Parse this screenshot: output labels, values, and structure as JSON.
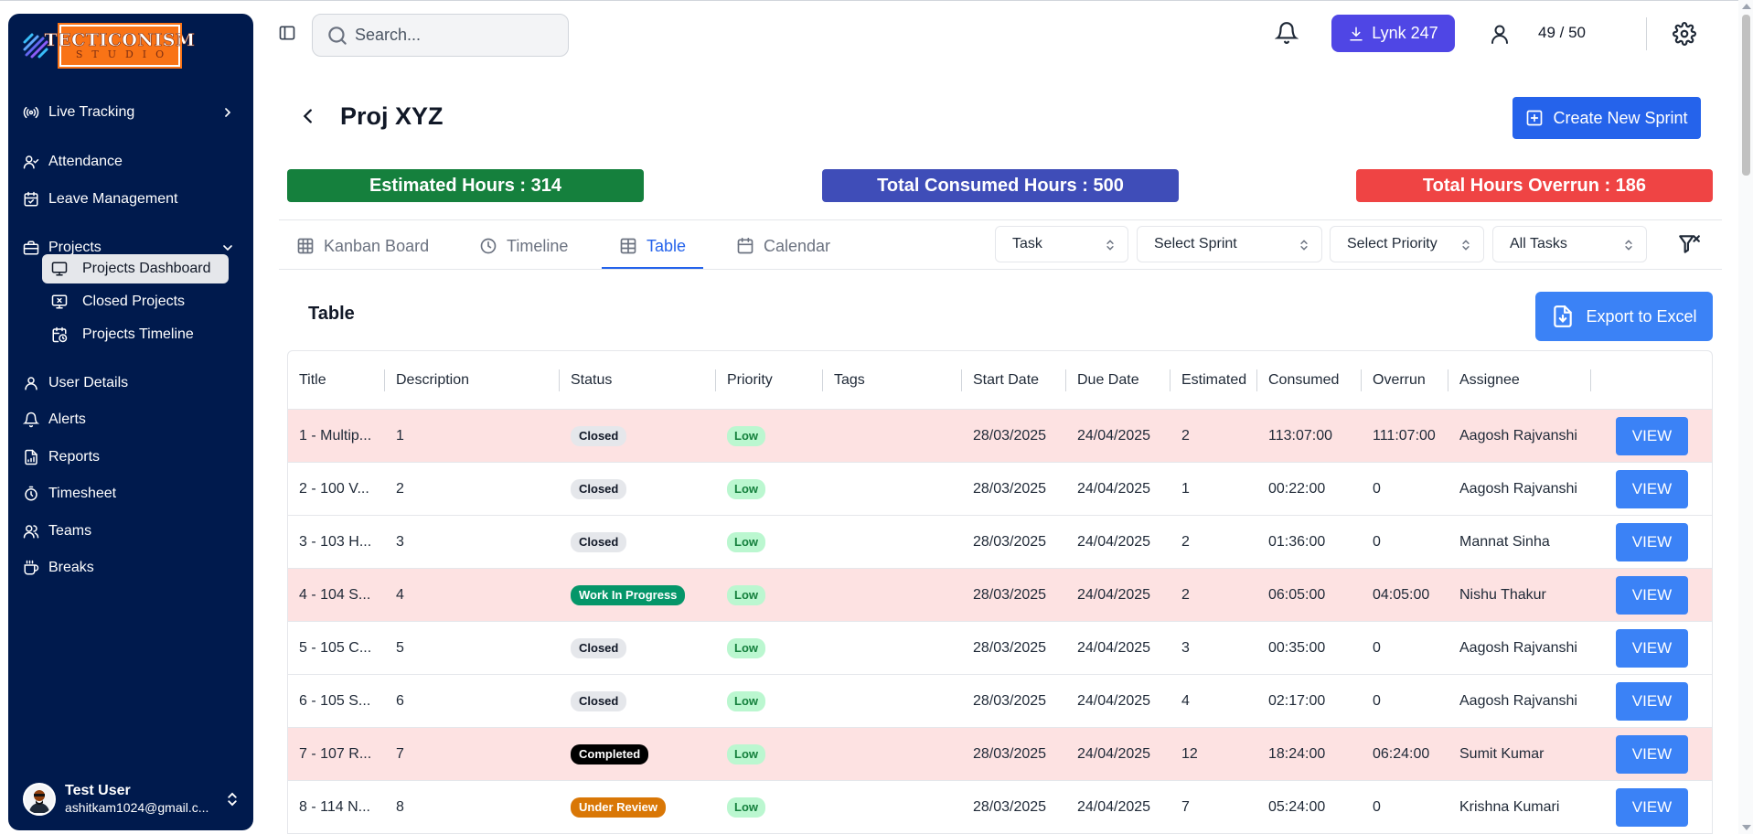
{
  "brand": {
    "logo_line1": "TECTICONISM",
    "logo_line2": "STUDIO"
  },
  "sidebar": {
    "items": [
      {
        "label": "Live Tracking"
      },
      {
        "label": "Attendance"
      },
      {
        "label": "Leave Management"
      },
      {
        "label": "Projects"
      },
      {
        "label": "User Details"
      },
      {
        "label": "Alerts"
      },
      {
        "label": "Reports"
      },
      {
        "label": "Timesheet"
      },
      {
        "label": "Teams"
      },
      {
        "label": "Breaks"
      }
    ],
    "sub_items": [
      {
        "label": "Projects Dashboard",
        "active": true
      },
      {
        "label": "Closed Projects"
      },
      {
        "label": "Projects Timeline"
      }
    ],
    "user": {
      "name": "Test User",
      "email": "ashitkam1024@gmail.c..."
    }
  },
  "topbar": {
    "search_placeholder": "Search...",
    "lynk_label": "Lynk 247",
    "user_count": "49 / 50"
  },
  "header": {
    "title": "Proj XYZ",
    "create_label": "Create New Sprint"
  },
  "stats": {
    "estimated": "Estimated Hours : 314",
    "consumed": "Total Consumed Hours : 500",
    "overrun": "Total Hours Overrun : 186"
  },
  "tabs": [
    {
      "label": "Kanban Board"
    },
    {
      "label": "Timeline"
    },
    {
      "label": "Table",
      "active": true
    },
    {
      "label": "Calendar"
    }
  ],
  "filters": {
    "type": "Task",
    "sprint": "Select Sprint",
    "priority": "Select Priority",
    "tasks": "All Tasks"
  },
  "table": {
    "section_title": "Table",
    "export_label": "Export to Excel",
    "columns": [
      "Title",
      "Description",
      "Status",
      "Priority",
      "Tags",
      "Start Date",
      "Due Date",
      "Estimated",
      "Consumed",
      "Overrun",
      "Assignee"
    ],
    "view_label": "VIEW",
    "rows": [
      {
        "title": "1 - Multip...",
        "description": "1",
        "status": "Closed",
        "priority": "Low",
        "start": "28/03/2025",
        "due": "24/04/2025",
        "estimated": "2",
        "consumed": "113:07:00",
        "overrun": "111:07:00",
        "assignee": "Aagosh Rajvanshi"
      },
      {
        "title": "2 - 100 V...",
        "description": "2",
        "status": "Closed",
        "priority": "Low",
        "start": "28/03/2025",
        "due": "24/04/2025",
        "estimated": "1",
        "consumed": "00:22:00",
        "overrun": "0",
        "assignee": "Aagosh Rajvanshi"
      },
      {
        "title": "3 - 103 H...",
        "description": "3",
        "status": "Closed",
        "priority": "Low",
        "start": "28/03/2025",
        "due": "24/04/2025",
        "estimated": "2",
        "consumed": "01:36:00",
        "overrun": "0",
        "assignee": "Mannat Sinha"
      },
      {
        "title": "4 - 104 S...",
        "description": "4",
        "status": "Work In Progress",
        "priority": "Low",
        "start": "28/03/2025",
        "due": "24/04/2025",
        "estimated": "2",
        "consumed": "06:05:00",
        "overrun": "04:05:00",
        "assignee": "Nishu Thakur"
      },
      {
        "title": "5 - 105 C...",
        "description": "5",
        "status": "Closed",
        "priority": "Low",
        "start": "28/03/2025",
        "due": "24/04/2025",
        "estimated": "3",
        "consumed": "00:35:00",
        "overrun": "0",
        "assignee": "Aagosh Rajvanshi"
      },
      {
        "title": "6 - 105 S...",
        "description": "6",
        "status": "Closed",
        "priority": "Low",
        "start": "28/03/2025",
        "due": "24/04/2025",
        "estimated": "4",
        "consumed": "02:17:00",
        "overrun": "0",
        "assignee": "Aagosh Rajvanshi"
      },
      {
        "title": "7 - 107 R...",
        "description": "7",
        "status": "Completed",
        "priority": "Low",
        "start": "28/03/2025",
        "due": "24/04/2025",
        "estimated": "12",
        "consumed": "18:24:00",
        "overrun": "06:24:00",
        "assignee": "Sumit Kumar"
      },
      {
        "title": "8 - 114 N...",
        "description": "8",
        "status": "Under Review",
        "priority": "Low",
        "start": "28/03/2025",
        "due": "24/04/2025",
        "estimated": "7",
        "consumed": "05:24:00",
        "overrun": "0",
        "assignee": "Krishna Kumari"
      }
    ]
  },
  "colors": {
    "sidebar_bg": "#001a4d",
    "primary": "#2563eb",
    "estimated": "#15803d",
    "consumed": "#3f4db8",
    "overrun": "#ef4444",
    "overrun_row": "#fde2e2"
  }
}
